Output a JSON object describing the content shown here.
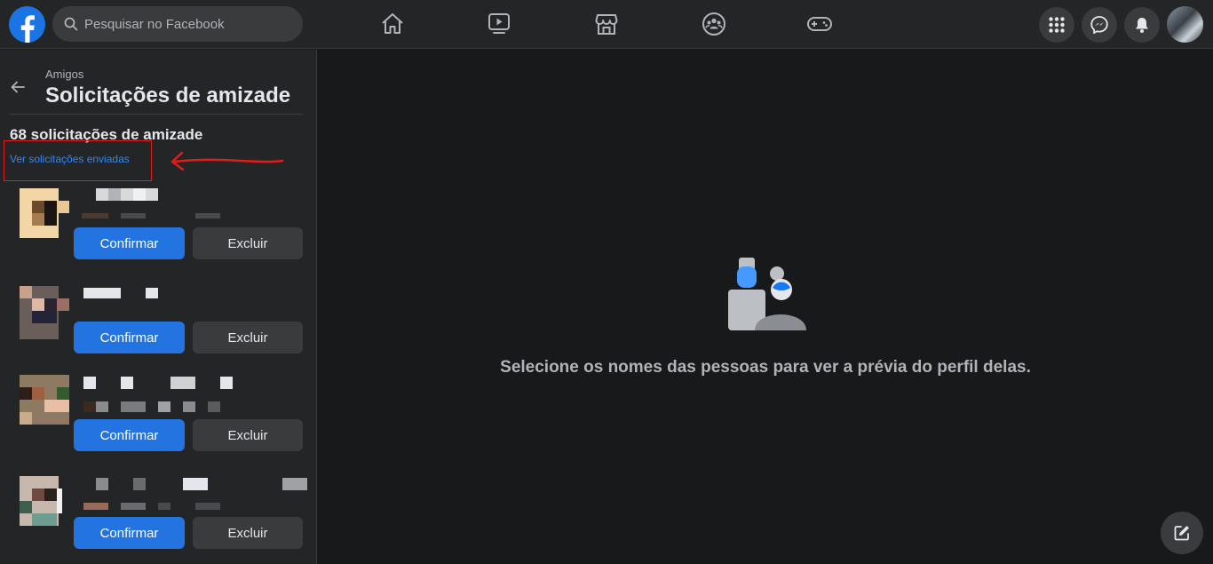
{
  "topbar": {
    "search_placeholder": "Pesquisar no Facebook",
    "nav": [
      "home-icon",
      "watch-icon",
      "marketplace-icon",
      "groups-icon",
      "gaming-icon"
    ],
    "right": [
      "menu-grid-icon",
      "messenger-icon",
      "notifications-icon"
    ]
  },
  "sidebar": {
    "breadcrumb": "Amigos",
    "title": "Solicitações de amizade",
    "count": "68 solicitações de amizade",
    "sent_link": "Ver solicitações enviadas",
    "requests": [
      {
        "confirm": "Confirmar",
        "delete": "Excluir"
      },
      {
        "confirm": "Confirmar",
        "delete": "Excluir"
      },
      {
        "confirm": "Confirmar",
        "delete": "Excluir"
      },
      {
        "confirm": "Confirmar",
        "delete": "Excluir"
      }
    ]
  },
  "main": {
    "empty_message": "Selecione os nomes das pessoas para ver a prévia do perfil delas."
  },
  "colors": {
    "accent": "#2374e1",
    "link": "#2d88ff",
    "annotation": "#e21b1b"
  }
}
